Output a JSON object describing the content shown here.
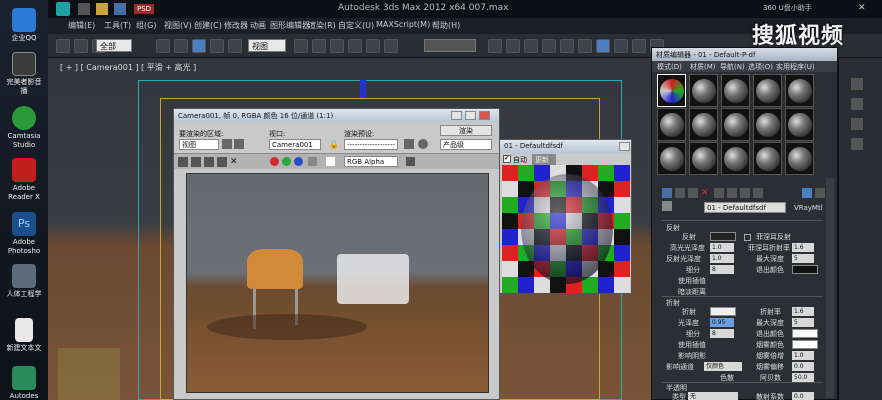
{
  "app": {
    "title": "Autodesk 3ds Max  2012 x64      007.max",
    "menus": [
      "编辑(E)",
      "工具(T)",
      "组(G)",
      "视图(V)",
      "创建(C)",
      "修改器",
      "动画",
      "图形编辑器",
      "渲染(R)",
      "自定义(U)",
      "MAXScript(M)",
      "帮助(H)"
    ],
    "toolbar": {
      "filter_combo": "全部",
      "view_combo": "视图"
    },
    "badge": "PSD"
  },
  "system": {
    "info": "360 U盘小助手"
  },
  "desktop_icons": [
    {
      "label": "企业QQ",
      "color": "#2b7bd6"
    },
    {
      "label": "完美者影音播",
      "color": "#3b3b3b"
    },
    {
      "label": "Camtasia Studio",
      "color": "#2a9a3a"
    },
    {
      "label": "Adobe Reader X",
      "color": "#c41f1f"
    },
    {
      "label": "Adobe Photosho",
      "color": "#1c4e8c"
    },
    {
      "label": "人体工程学",
      "color": "#5a6a7a"
    },
    {
      "label": "新建文本文",
      "color": "#e8e8e8"
    },
    {
      "label": "Autodes",
      "color": "#2a8a5a"
    }
  ],
  "viewport": {
    "label": "[ + ] [ Camera001 ] [ 平滑 + 高光 ]"
  },
  "render_window": {
    "title": "Camera001, 帧 0, RGBA 颜色 16 位/通道 (1:1)",
    "area_label": "要渲染的区域:",
    "area_value": "视图",
    "viewport_label": "视口:",
    "viewport_value": "Camera001",
    "preset_label": "渲染预设:",
    "preset_value": "-------------------",
    "render_button": "渲染",
    "product_value": "产品级",
    "channel_value": "RGB Alpha"
  },
  "material_preview": {
    "title": "01 - Defaultdfsdf",
    "auto_label": "自动",
    "update_button": "更新"
  },
  "material_editor": {
    "title": "材质编辑器 - 01 - Default-P-df",
    "menus": [
      "模式(D)",
      "材质(M)",
      "导航(N)",
      "选项(O)",
      "实用程序(U)"
    ],
    "material_name": "01 - Defaultdfsdf",
    "material_type": "VRayMtl",
    "reflection": {
      "header": "反射",
      "color_label": "反射",
      "gloss_label": "高光光泽度",
      "gloss_value": "1.0",
      "refl_gloss_label": "反射光泽度",
      "refl_gloss_value": "1.0",
      "subdiv_label": "细分",
      "subdiv_value": "8",
      "interp_label": "使用插值",
      "cutoff_label": "退出颜色",
      "fresnel_label": "菲涅耳反射",
      "fresnel_ior_label": "菲涅耳折射率",
      "fresnel_ior_value": "1.6",
      "max_depth_label": "最大深度",
      "max_depth_value": "5",
      "dim_label": "暗淡距离"
    },
    "refraction": {
      "header": "折射",
      "color_label": "折射",
      "ior_label": "折射率",
      "ior_value": "1.6",
      "gloss_label": "光泽度",
      "gloss_value": "0.95",
      "max_depth_label": "最大深度",
      "max_depth_value": "5",
      "subdiv_label": "细分",
      "subdiv_value": "8",
      "exit_label": "退出颜色",
      "interp_label": "使用插值",
      "fog_color_label": "烟雾颜色",
      "shadow_label": "影响阴影",
      "fog_mult_label": "烟雾倍增",
      "fog_mult_value": "1.0",
      "fog_bias_label": "烟雾偏移",
      "fog_bias_value": "0.0",
      "affect_channel_label": "影响通道",
      "affect_channel_value": "仅颜色",
      "dispersion_label": "色散",
      "abbe_label": "阿贝数",
      "abbe_value": "50.0"
    },
    "translucency": {
      "header": "半透明",
      "type_label": "类型",
      "type_value": "无",
      "scatter_label": "散射系数",
      "scatter_value": "0.0"
    }
  },
  "watermark": "搜狐视频"
}
